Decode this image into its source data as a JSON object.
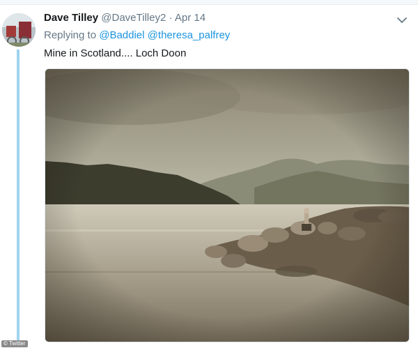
{
  "tweet": {
    "display_name": "Dave Tilley",
    "handle": "@DaveTilley2",
    "separator": "·",
    "date": "Apr 14",
    "replying_prefix": "Replying to",
    "mentions": [
      "@Baddiel",
      "@theresa_palfrey"
    ],
    "text": "Mine in Scotland.... Loch Doon"
  },
  "icons": {
    "menu": "chevron-down-icon"
  },
  "colors": {
    "link": "#1b95e0",
    "thread_line": "#9fd3ef",
    "muted": "#657786"
  },
  "watermark": "© Twitter"
}
